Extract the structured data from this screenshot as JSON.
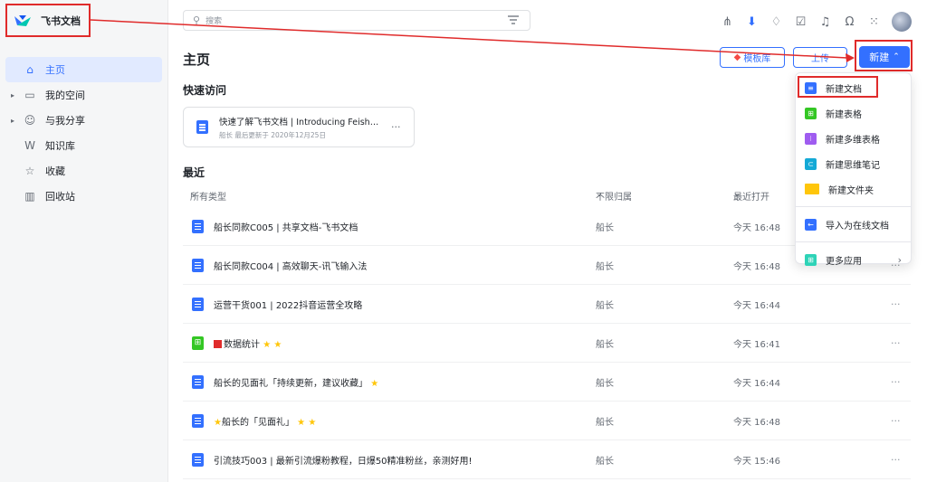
{
  "app": {
    "name": "飞书文档"
  },
  "sidebar": {
    "items": [
      {
        "label": "主页",
        "icon": "home-icon",
        "active": true,
        "caret": false
      },
      {
        "label": "我的空间",
        "icon": "folder-icon",
        "active": false,
        "caret": true
      },
      {
        "label": "与我分享",
        "icon": "people-icon",
        "active": false,
        "caret": true
      },
      {
        "label": "知识库",
        "icon": "wiki-icon",
        "active": false,
        "caret": false
      },
      {
        "label": "收藏",
        "icon": "star-icon",
        "active": false,
        "caret": false
      },
      {
        "label": "回收站",
        "icon": "trash-icon",
        "active": false,
        "caret": false
      }
    ]
  },
  "search": {
    "placeholder": "搜索"
  },
  "header": {
    "title": "主页",
    "template_btn": "模板库",
    "upload_btn": "上传",
    "new_btn": "新建"
  },
  "quick": {
    "title": "快速访问",
    "card": {
      "title": "快速了解飞书文档 | Introducing Feishu ...",
      "subtitle": "船长 最后更新于 2020年12月25日"
    }
  },
  "recent": {
    "title": "最近",
    "columns": [
      "所有类型",
      "不限归属",
      "最近打开"
    ],
    "rows": [
      {
        "type": "doc",
        "name": "船长同款C005 | 共享文档-飞书文档",
        "owner": "船长",
        "time": "今天 16:48"
      },
      {
        "type": "doc",
        "name": "船长同款C004 | 高效聊天-讯飞输入法",
        "owner": "船长",
        "time": "今天 16:48"
      },
      {
        "type": "doc",
        "name": "运营干货001 | 2022抖音运营全攻略",
        "owner": "船长",
        "time": "今天 16:44"
      },
      {
        "type": "sheet",
        "name": "数据统计",
        "owner": "船长",
        "time": "今天 16:41"
      },
      {
        "type": "doc",
        "name": "船长的见面礼「持续更新，建议收藏」",
        "owner": "船长",
        "time": "今天 16:44"
      },
      {
        "type": "doc",
        "name": "船长的「见面礼」",
        "owner": "船长",
        "time": "今天 16:48"
      },
      {
        "type": "doc",
        "name": "引流技巧003 | 最新引流爆粉教程，日爆50精准粉丝，亲测好用!",
        "owner": "船长",
        "time": "今天 15:46"
      }
    ]
  },
  "menu": {
    "items": [
      {
        "label": "新建文档",
        "color": "#3370ff",
        "glyph": "≡"
      },
      {
        "label": "新建表格",
        "color": "#34c724",
        "glyph": "⊞"
      },
      {
        "label": "新建多维表格",
        "color": "#9f5cf0",
        "glyph": "⁝"
      },
      {
        "label": "新建思维笔记",
        "color": "#14a9d6",
        "glyph": "⊂"
      },
      {
        "label": "新建文件夹",
        "color": "#ffc60a",
        "glyph": ""
      },
      {
        "label": "导入为在线文档",
        "color": "#3370ff",
        "glyph": "←"
      },
      {
        "label": "更多应用",
        "color": "#2ed3b7",
        "glyph": "⊞"
      }
    ]
  },
  "colors": {
    "accent": "#3370ff",
    "annotation": "#e02b2b"
  }
}
